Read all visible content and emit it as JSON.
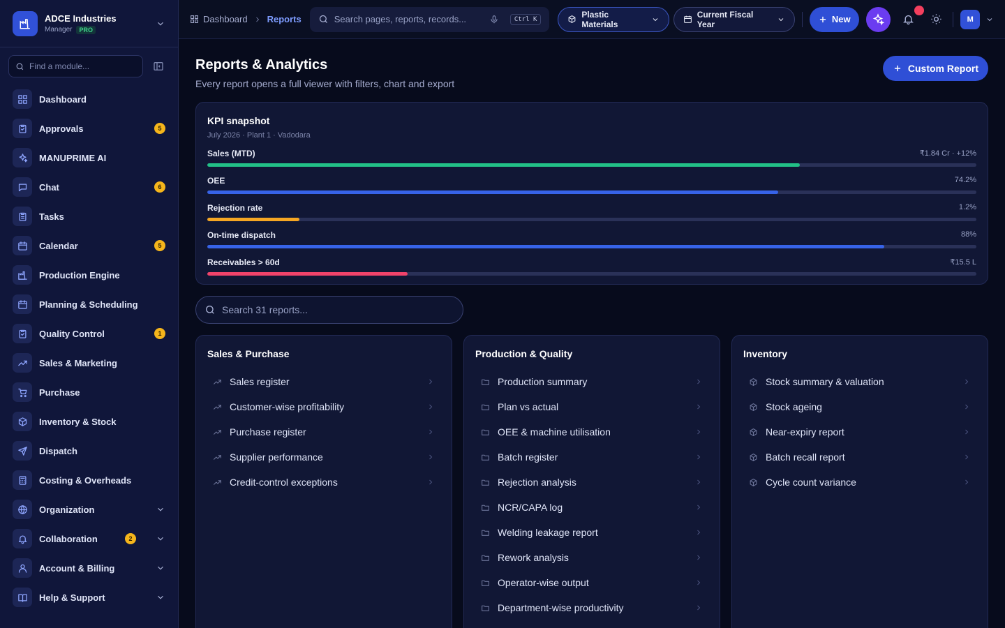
{
  "brand": {
    "name": "ADCE Industries",
    "role": "Manager",
    "badge": "PRO"
  },
  "sidebar": {
    "search_placeholder": "Find a module...",
    "items": [
      {
        "label": "Dashboard",
        "icon": "dashboard-icon"
      },
      {
        "label": "Approvals",
        "icon": "clipboard-check-icon",
        "badge": "5"
      },
      {
        "label": "MANUPRIME AI",
        "icon": "sparkle-icon"
      },
      {
        "label": "Chat",
        "icon": "chat-icon",
        "badge": "6"
      },
      {
        "label": "Tasks",
        "icon": "clipboard-list-icon"
      },
      {
        "label": "Calendar",
        "icon": "calendar-icon",
        "badge": "5"
      },
      {
        "label": "Production Engine",
        "icon": "factory-icon"
      },
      {
        "label": "Planning & Scheduling",
        "icon": "calendar-icon"
      },
      {
        "label": "Quality Control",
        "icon": "clipboard-check-icon",
        "badge": "1"
      },
      {
        "label": "Sales & Marketing",
        "icon": "trend-up-icon"
      },
      {
        "label": "Purchase",
        "icon": "cart-icon"
      },
      {
        "label": "Inventory & Stock",
        "icon": "box-icon"
      },
      {
        "label": "Dispatch",
        "icon": "send-icon"
      },
      {
        "label": "Costing & Overheads",
        "icon": "calculator-icon"
      },
      {
        "label": "Organization",
        "icon": "globe-icon",
        "expandable": true
      },
      {
        "label": "Collaboration",
        "icon": "bell-icon",
        "badge": "2",
        "expandable": true
      },
      {
        "label": "Account & Billing",
        "icon": "user-icon",
        "expandable": true
      },
      {
        "label": "Help & Support",
        "icon": "book-icon",
        "expandable": true
      }
    ]
  },
  "topbar": {
    "breadcrumb": [
      "Dashboard",
      "Reports"
    ],
    "search_placeholder": "Search pages, reports, records...",
    "shortcut": "Ctrl K",
    "division": "Plastic Materials",
    "period": "Current Fiscal Year",
    "new_label": "New",
    "avatar_initial": "M"
  },
  "page": {
    "title": "Reports & Analytics",
    "subtitle": "Every report opens a full viewer with filters, chart and export",
    "custom_report_label": "Custom Report"
  },
  "kpi": {
    "title": "KPI snapshot",
    "subtitle": "July 2026 · Plant 1 · Vadodara",
    "rows": [
      {
        "label": "Sales (MTD)",
        "value": "₹1.84 Cr · +12%",
        "fill": 0.77,
        "color": "#22c087"
      },
      {
        "label": "OEE",
        "value": "74.2%",
        "fill": 0.742,
        "color": "#3763e8"
      },
      {
        "label": "Rejection rate",
        "value": "1.2%",
        "fill": 0.12,
        "color": "#f5a623"
      },
      {
        "label": "On-time dispatch",
        "value": "88%",
        "fill": 0.88,
        "color": "#3763e8"
      },
      {
        "label": "Receivables > 60d",
        "value": "₹15.5 L",
        "fill": 0.26,
        "color": "#f0436a"
      }
    ]
  },
  "reports_search_placeholder": "Search 31 reports...",
  "categories": [
    {
      "title": "Sales & Purchase",
      "icon": "trend-up-icon",
      "items": [
        "Sales register",
        "Customer-wise profitability",
        "Purchase register",
        "Supplier performance",
        "Credit-control exceptions"
      ]
    },
    {
      "title": "Production & Quality",
      "icon": "factory-icon",
      "items": [
        "Production summary",
        "Plan vs actual",
        "OEE & machine utilisation",
        "Batch register",
        "Rejection analysis",
        "NCR/CAPA log",
        "Welding leakage report",
        "Rework analysis",
        "Operator-wise output",
        "Department-wise productivity"
      ]
    },
    {
      "title": "Inventory",
      "icon": "box-icon",
      "items": [
        "Stock summary & valuation",
        "Stock ageing",
        "Near-expiry report",
        "Batch recall report",
        "Cycle count variance"
      ]
    }
  ]
}
